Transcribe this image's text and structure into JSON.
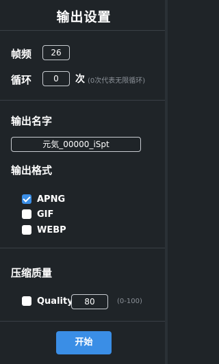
{
  "title": "输出设置",
  "frame": {
    "label": "帧频",
    "value": "26"
  },
  "loop": {
    "label": "循环",
    "value": "0",
    "unit": "次",
    "hint": "(0次代表无限循环)"
  },
  "output_name": {
    "label": "输出名字",
    "value": "元気_00000_iSpt"
  },
  "output_format": {
    "label": "输出格式",
    "options": [
      {
        "label": "APNG",
        "checked": true
      },
      {
        "label": "GIF",
        "checked": false
      },
      {
        "label": "WEBP",
        "checked": false
      }
    ]
  },
  "compress": {
    "label": "压缩质量",
    "quality_label": "Quality",
    "quality_checked": false,
    "value": "80",
    "range_hint": "(0-100)"
  },
  "start_button": "开始",
  "colors": {
    "background": "#1f2428",
    "accent": "#3a8ee6",
    "divider": "#3a4046"
  }
}
